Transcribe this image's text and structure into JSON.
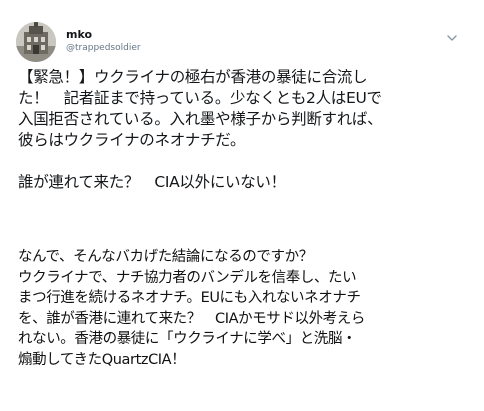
{
  "tweet": {
    "display_name": "mko",
    "handle": "@trappedsoldier",
    "menu_icon": "chevron-down-icon",
    "avatar_icon": "building-avatar",
    "body_lines": [
      "【緊急！】ウクライナの極右が香港の暴徒に合流し",
      "た！　記者証まで持っている。少なくとも2人はEUで",
      "入国拒否されている。入れ墨や様子から判断すれば、",
      "彼らはウクライナのネオナチだ。",
      "",
      "誰が連れて来た？　CIA以外にいない！"
    ]
  },
  "reply": {
    "lines": [
      "なんで、そんなバカげた結論になるのですか？",
      "ウクライナで、ナチ協力者のバンデルを信奉し、たい",
      "まつ行進を続けるネオナチ。EUにも入れないネオナチ",
      "を、誰が香港に連れて来た？　CIAかモサド以外考えら",
      "れない。香港の暴徒に「ウクライナに学べ」と洗脳・",
      "煽動してきたQuartzCIA！"
    ]
  }
}
